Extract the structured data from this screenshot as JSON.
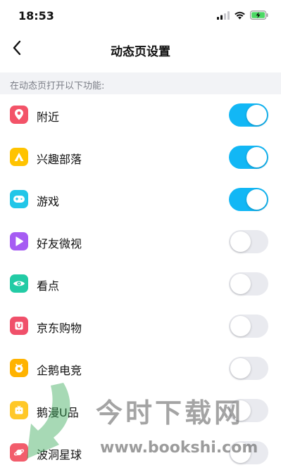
{
  "status_bar": {
    "time": "18:53",
    "icons": [
      "cellular-signal-icon",
      "wifi-icon",
      "battery-charging-icon"
    ]
  },
  "nav": {
    "title": "动态页设置",
    "back_icon": "chevron-left-icon"
  },
  "section": {
    "header": "在动态页打开以下功能:"
  },
  "features": [
    {
      "label": "附近",
      "icon": "location-pin-icon",
      "icon_color": "#f35368",
      "enabled": true
    },
    {
      "label": "兴趣部落",
      "icon": "tent-icon",
      "icon_color": "#ffc300",
      "enabled": true
    },
    {
      "label": "游戏",
      "icon": "gamepad-icon",
      "icon_color": "#22c6e8",
      "enabled": true
    },
    {
      "label": "好友微视",
      "icon": "play-icon",
      "icon_color": "#a65cf3",
      "enabled": false
    },
    {
      "label": "看点",
      "icon": "eye-icon",
      "icon_color": "#22cba5",
      "enabled": false
    },
    {
      "label": "京东购物",
      "icon": "shopping-bag-icon",
      "icon_color": "#f0506a",
      "enabled": false
    },
    {
      "label": "企鹅电竞",
      "icon": "esports-icon",
      "icon_color": "#ffb300",
      "enabled": false
    },
    {
      "label": "鹅漫U品",
      "icon": "gift-box-icon",
      "icon_color": "#ffc828",
      "enabled": false
    },
    {
      "label": "波洞星球",
      "icon": "planet-icon",
      "icon_color": "#f25d6c",
      "enabled": false
    }
  ],
  "colors": {
    "toggle_on": "#12b7f5",
    "toggle_off": "#e9eaef",
    "section_bg": "#f2f3f6"
  },
  "watermark": {
    "text": "今时下载网",
    "url": "www.bookshi.com"
  }
}
